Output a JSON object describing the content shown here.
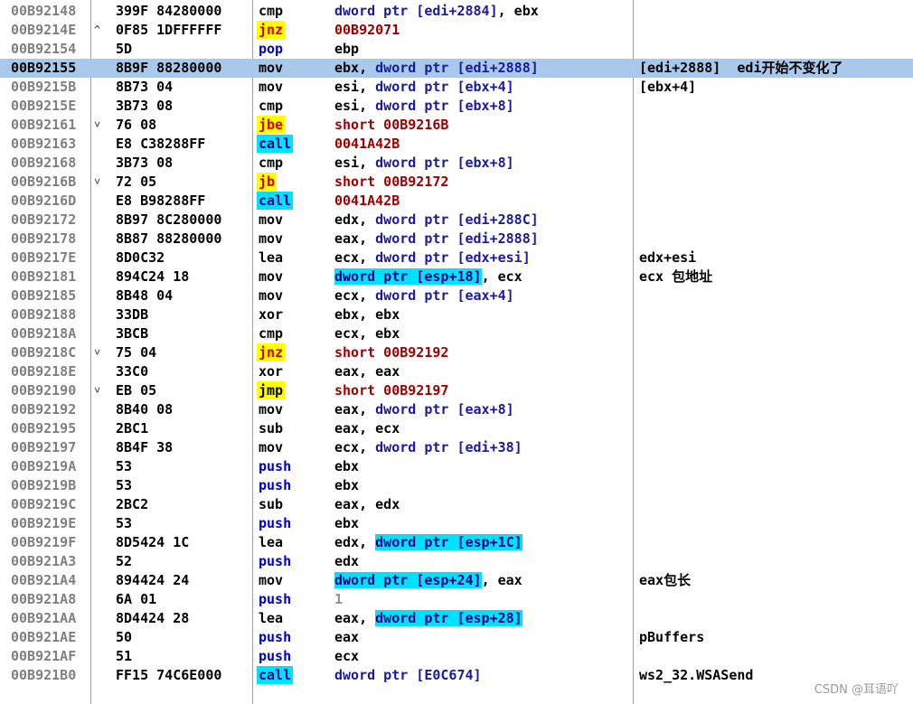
{
  "columns_hint": [
    "address",
    "hex",
    "disassembly",
    "comment"
  ],
  "rows": [
    {
      "addr": "00B92148",
      "jump": "",
      "hex": "399F 84280000",
      "mnem": "cmp",
      "mtype": "plain",
      "ops": [
        {
          "t": "dword ptr [edi+2884]",
          "k": "ptr"
        },
        {
          "t": ", ebx",
          "k": "plain"
        }
      ],
      "comment": ""
    },
    {
      "addr": "00B9214E",
      "jump": "^",
      "hex": "0F85 1DFFFFFF",
      "mnem": "jnz",
      "mtype": "jump",
      "ops": [
        {
          "t": "00B92071",
          "k": "target"
        }
      ],
      "comment": ""
    },
    {
      "addr": "00B92154",
      "jump": "",
      "hex": "5D",
      "mnem": "pop",
      "mtype": "stack",
      "ops": [
        {
          "t": "ebp",
          "k": "plain"
        }
      ],
      "comment": ""
    },
    {
      "addr": "00B92155",
      "jump": "",
      "hex": "8B9F 88280000",
      "mnem": "mov",
      "mtype": "plain",
      "ops": [
        {
          "t": "ebx, ",
          "k": "plain"
        },
        {
          "t": "dword ptr [edi+2888]",
          "k": "ptr"
        }
      ],
      "comment": "[edi+2888]  edi开始不变化了",
      "selected": true
    },
    {
      "addr": "00B9215B",
      "jump": "",
      "hex": "8B73 04",
      "mnem": "mov",
      "mtype": "plain",
      "ops": [
        {
          "t": "esi, ",
          "k": "plain"
        },
        {
          "t": "dword ptr [ebx+4]",
          "k": "ptr"
        }
      ],
      "comment": "[ebx+4]"
    },
    {
      "addr": "00B9215E",
      "jump": "",
      "hex": "3B73 08",
      "mnem": "cmp",
      "mtype": "plain",
      "ops": [
        {
          "t": "esi, ",
          "k": "plain"
        },
        {
          "t": "dword ptr [ebx+8]",
          "k": "ptr"
        }
      ],
      "comment": ""
    },
    {
      "addr": "00B92161",
      "jump": "v",
      "hex": "76 08",
      "mnem": "jbe",
      "mtype": "jump",
      "ops": [
        {
          "t": "short 00B9216B",
          "k": "target"
        }
      ],
      "comment": ""
    },
    {
      "addr": "00B92163",
      "jump": "",
      "hex": "E8 C38288FF",
      "mnem": "call",
      "mtype": "call",
      "ops": [
        {
          "t": "0041A42B",
          "k": "target"
        }
      ],
      "comment": ""
    },
    {
      "addr": "00B92168",
      "jump": "",
      "hex": "3B73 08",
      "mnem": "cmp",
      "mtype": "plain",
      "ops": [
        {
          "t": "esi, ",
          "k": "plain"
        },
        {
          "t": "dword ptr [ebx+8]",
          "k": "ptr"
        }
      ],
      "comment": ""
    },
    {
      "addr": "00B9216B",
      "jump": "v",
      "hex": "72 05",
      "mnem": "jb",
      "mtype": "jump",
      "ops": [
        {
          "t": "short 00B92172",
          "k": "target"
        }
      ],
      "comment": ""
    },
    {
      "addr": "00B9216D",
      "jump": "",
      "hex": "E8 B98288FF",
      "mnem": "call",
      "mtype": "call",
      "ops": [
        {
          "t": "0041A42B",
          "k": "target"
        }
      ],
      "comment": ""
    },
    {
      "addr": "00B92172",
      "jump": "",
      "hex": "8B97 8C280000",
      "mnem": "mov",
      "mtype": "plain",
      "ops": [
        {
          "t": "edx, ",
          "k": "plain"
        },
        {
          "t": "dword ptr [edi+288C]",
          "k": "ptr"
        }
      ],
      "comment": ""
    },
    {
      "addr": "00B92178",
      "jump": "",
      "hex": "8B87 88280000",
      "mnem": "mov",
      "mtype": "plain",
      "ops": [
        {
          "t": "eax, ",
          "k": "plain"
        },
        {
          "t": "dword ptr [edi+2888]",
          "k": "ptr"
        }
      ],
      "comment": ""
    },
    {
      "addr": "00B9217E",
      "jump": "",
      "hex": "8D0C32",
      "mnem": "lea",
      "mtype": "plain",
      "ops": [
        {
          "t": "ecx, ",
          "k": "plain"
        },
        {
          "t": "dword ptr [edx+esi]",
          "k": "ptr"
        }
      ],
      "comment": "edx+esi"
    },
    {
      "addr": "00B92181",
      "jump": "",
      "hex": "894C24 18",
      "mnem": "mov",
      "mtype": "plain",
      "ops": [
        {
          "t": "dword ptr [esp+18]",
          "k": "hl"
        },
        {
          "t": ", ecx",
          "k": "plain"
        }
      ],
      "comment": "ecx 包地址"
    },
    {
      "addr": "00B92185",
      "jump": "",
      "hex": "8B48 04",
      "mnem": "mov",
      "mtype": "plain",
      "ops": [
        {
          "t": "ecx, ",
          "k": "plain"
        },
        {
          "t": "dword ptr [eax+4]",
          "k": "ptr"
        }
      ],
      "comment": ""
    },
    {
      "addr": "00B92188",
      "jump": "",
      "hex": "33DB",
      "mnem": "xor",
      "mtype": "plain",
      "ops": [
        {
          "t": "ebx, ebx",
          "k": "plain"
        }
      ],
      "comment": ""
    },
    {
      "addr": "00B9218A",
      "jump": "",
      "hex": "3BCB",
      "mnem": "cmp",
      "mtype": "plain",
      "ops": [
        {
          "t": "ecx, ebx",
          "k": "plain"
        }
      ],
      "comment": ""
    },
    {
      "addr": "00B9218C",
      "jump": "v",
      "hex": "75 04",
      "mnem": "jnz",
      "mtype": "jump",
      "ops": [
        {
          "t": "short 00B92192",
          "k": "target"
        }
      ],
      "comment": ""
    },
    {
      "addr": "00B9218E",
      "jump": "",
      "hex": "33C0",
      "mnem": "xor",
      "mtype": "plain",
      "ops": [
        {
          "t": "eax, eax",
          "k": "plain"
        }
      ],
      "comment": ""
    },
    {
      "addr": "00B92190",
      "jump": "v",
      "hex": "EB 05",
      "mnem": "jmp",
      "mtype": "jmp",
      "ops": [
        {
          "t": "short 00B92197",
          "k": "target"
        }
      ],
      "comment": ""
    },
    {
      "addr": "00B92192",
      "jump": "",
      "hex": "8B40 08",
      "mnem": "mov",
      "mtype": "plain",
      "ops": [
        {
          "t": "eax, ",
          "k": "plain"
        },
        {
          "t": "dword ptr [eax+8]",
          "k": "ptr"
        }
      ],
      "comment": ""
    },
    {
      "addr": "00B92195",
      "jump": "",
      "hex": "2BC1",
      "mnem": "sub",
      "mtype": "plain",
      "ops": [
        {
          "t": "eax, ecx",
          "k": "plain"
        }
      ],
      "comment": ""
    },
    {
      "addr": "00B92197",
      "jump": "",
      "hex": "8B4F 38",
      "mnem": "mov",
      "mtype": "plain",
      "ops": [
        {
          "t": "ecx, ",
          "k": "plain"
        },
        {
          "t": "dword ptr [edi+38]",
          "k": "ptr"
        }
      ],
      "comment": ""
    },
    {
      "addr": "00B9219A",
      "jump": "",
      "hex": "53",
      "mnem": "push",
      "mtype": "stack",
      "ops": [
        {
          "t": "ebx",
          "k": "plain"
        }
      ],
      "comment": ""
    },
    {
      "addr": "00B9219B",
      "jump": "",
      "hex": "53",
      "mnem": "push",
      "mtype": "stack",
      "ops": [
        {
          "t": "ebx",
          "k": "plain"
        }
      ],
      "comment": ""
    },
    {
      "addr": "00B9219C",
      "jump": "",
      "hex": "2BC2",
      "mnem": "sub",
      "mtype": "plain",
      "ops": [
        {
          "t": "eax, edx",
          "k": "plain"
        }
      ],
      "comment": ""
    },
    {
      "addr": "00B9219E",
      "jump": "",
      "hex": "53",
      "mnem": "push",
      "mtype": "stack",
      "ops": [
        {
          "t": "ebx",
          "k": "plain"
        }
      ],
      "comment": ""
    },
    {
      "addr": "00B9219F",
      "jump": "",
      "hex": "8D5424 1C",
      "mnem": "lea",
      "mtype": "plain",
      "ops": [
        {
          "t": "edx, ",
          "k": "plain"
        },
        {
          "t": "dword ptr [esp+1C]",
          "k": "hl"
        }
      ],
      "comment": ""
    },
    {
      "addr": "00B921A3",
      "jump": "",
      "hex": "52",
      "mnem": "push",
      "mtype": "stack",
      "ops": [
        {
          "t": "edx",
          "k": "plain"
        }
      ],
      "comment": ""
    },
    {
      "addr": "00B921A4",
      "jump": "",
      "hex": "894424 24",
      "mnem": "mov",
      "mtype": "plain",
      "ops": [
        {
          "t": "dword ptr [esp+24]",
          "k": "hl"
        },
        {
          "t": ", eax",
          "k": "plain"
        }
      ],
      "comment": "eax包长"
    },
    {
      "addr": "00B921A8",
      "jump": "",
      "hex": "6A 01",
      "mnem": "push",
      "mtype": "stack",
      "ops": [
        {
          "t": "1",
          "k": "imm"
        }
      ],
      "comment": ""
    },
    {
      "addr": "00B921AA",
      "jump": "",
      "hex": "8D4424 28",
      "mnem": "lea",
      "mtype": "plain",
      "ops": [
        {
          "t": "eax, ",
          "k": "plain"
        },
        {
          "t": "dword ptr [esp+28]",
          "k": "hl"
        }
      ],
      "comment": ""
    },
    {
      "addr": "00B921AE",
      "jump": "",
      "hex": "50",
      "mnem": "push",
      "mtype": "stack",
      "ops": [
        {
          "t": "eax",
          "k": "plain"
        }
      ],
      "comment": "pBuffers"
    },
    {
      "addr": "00B921AF",
      "jump": "",
      "hex": "51",
      "mnem": "push",
      "mtype": "stack",
      "ops": [
        {
          "t": "ecx",
          "k": "plain"
        }
      ],
      "comment": ""
    },
    {
      "addr": "00B921B0",
      "jump": "",
      "hex": "FF15 74C6E000",
      "mnem": "call",
      "mtype": "call",
      "ops": [
        {
          "t": "dword ptr [E0C674]",
          "k": "ptr"
        }
      ],
      "comment": "ws2_32.WSASend"
    }
  ],
  "watermark": "CSDN @耳语吖",
  "colors": {
    "jump_bg": "#ffff00",
    "jump_fg": "#d00000",
    "call_bg": "#00e0ff",
    "call_fg": "#000080",
    "jmp_bg": "#ffff00",
    "jmp_fg": "#000000",
    "stack_fg": "#0000c0",
    "ptr_fg": "#1a1a9a",
    "target_fg": "#a00000",
    "hl_bg": "#00e0ff",
    "hl_fg": "#000080",
    "imm_fg": "#909090",
    "selected_bg": "#a8c8ec"
  }
}
